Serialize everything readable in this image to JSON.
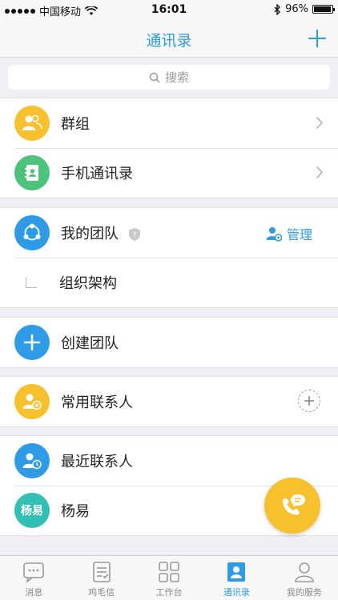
{
  "status_bar": {
    "carrier": "中国移动",
    "time": "16:01",
    "battery": "96%",
    "battery_level": 0.96
  },
  "nav": {
    "title": "通讯录"
  },
  "search": {
    "placeholder": "搜索"
  },
  "rows": {
    "groups": "群组",
    "phone_contacts": "手机通讯录",
    "my_team": "我的团队",
    "manage": "管理",
    "org_structure": "组织架构",
    "create_team": "创建团队",
    "frequent_contacts": "常用联系人",
    "recent_contacts": "最近联系人",
    "contact_name": "杨易",
    "contact_avatar_text": "杨易"
  },
  "tabs": [
    {
      "label": "消息",
      "icon": "message-icon",
      "active": false
    },
    {
      "label": "鸡毛信",
      "icon": "checklist-icon",
      "active": false
    },
    {
      "label": "工作台",
      "icon": "grid-icon",
      "active": false
    },
    {
      "label": "通讯录",
      "icon": "contacts-icon",
      "active": true
    },
    {
      "label": "我的服务",
      "icon": "person-icon",
      "active": false
    }
  ],
  "colors": {
    "accent": "#2d9be6",
    "yellow": "#f7c12e",
    "green": "#4cc27a",
    "blue": "#2d9be6",
    "teal": "#33c0b4"
  }
}
